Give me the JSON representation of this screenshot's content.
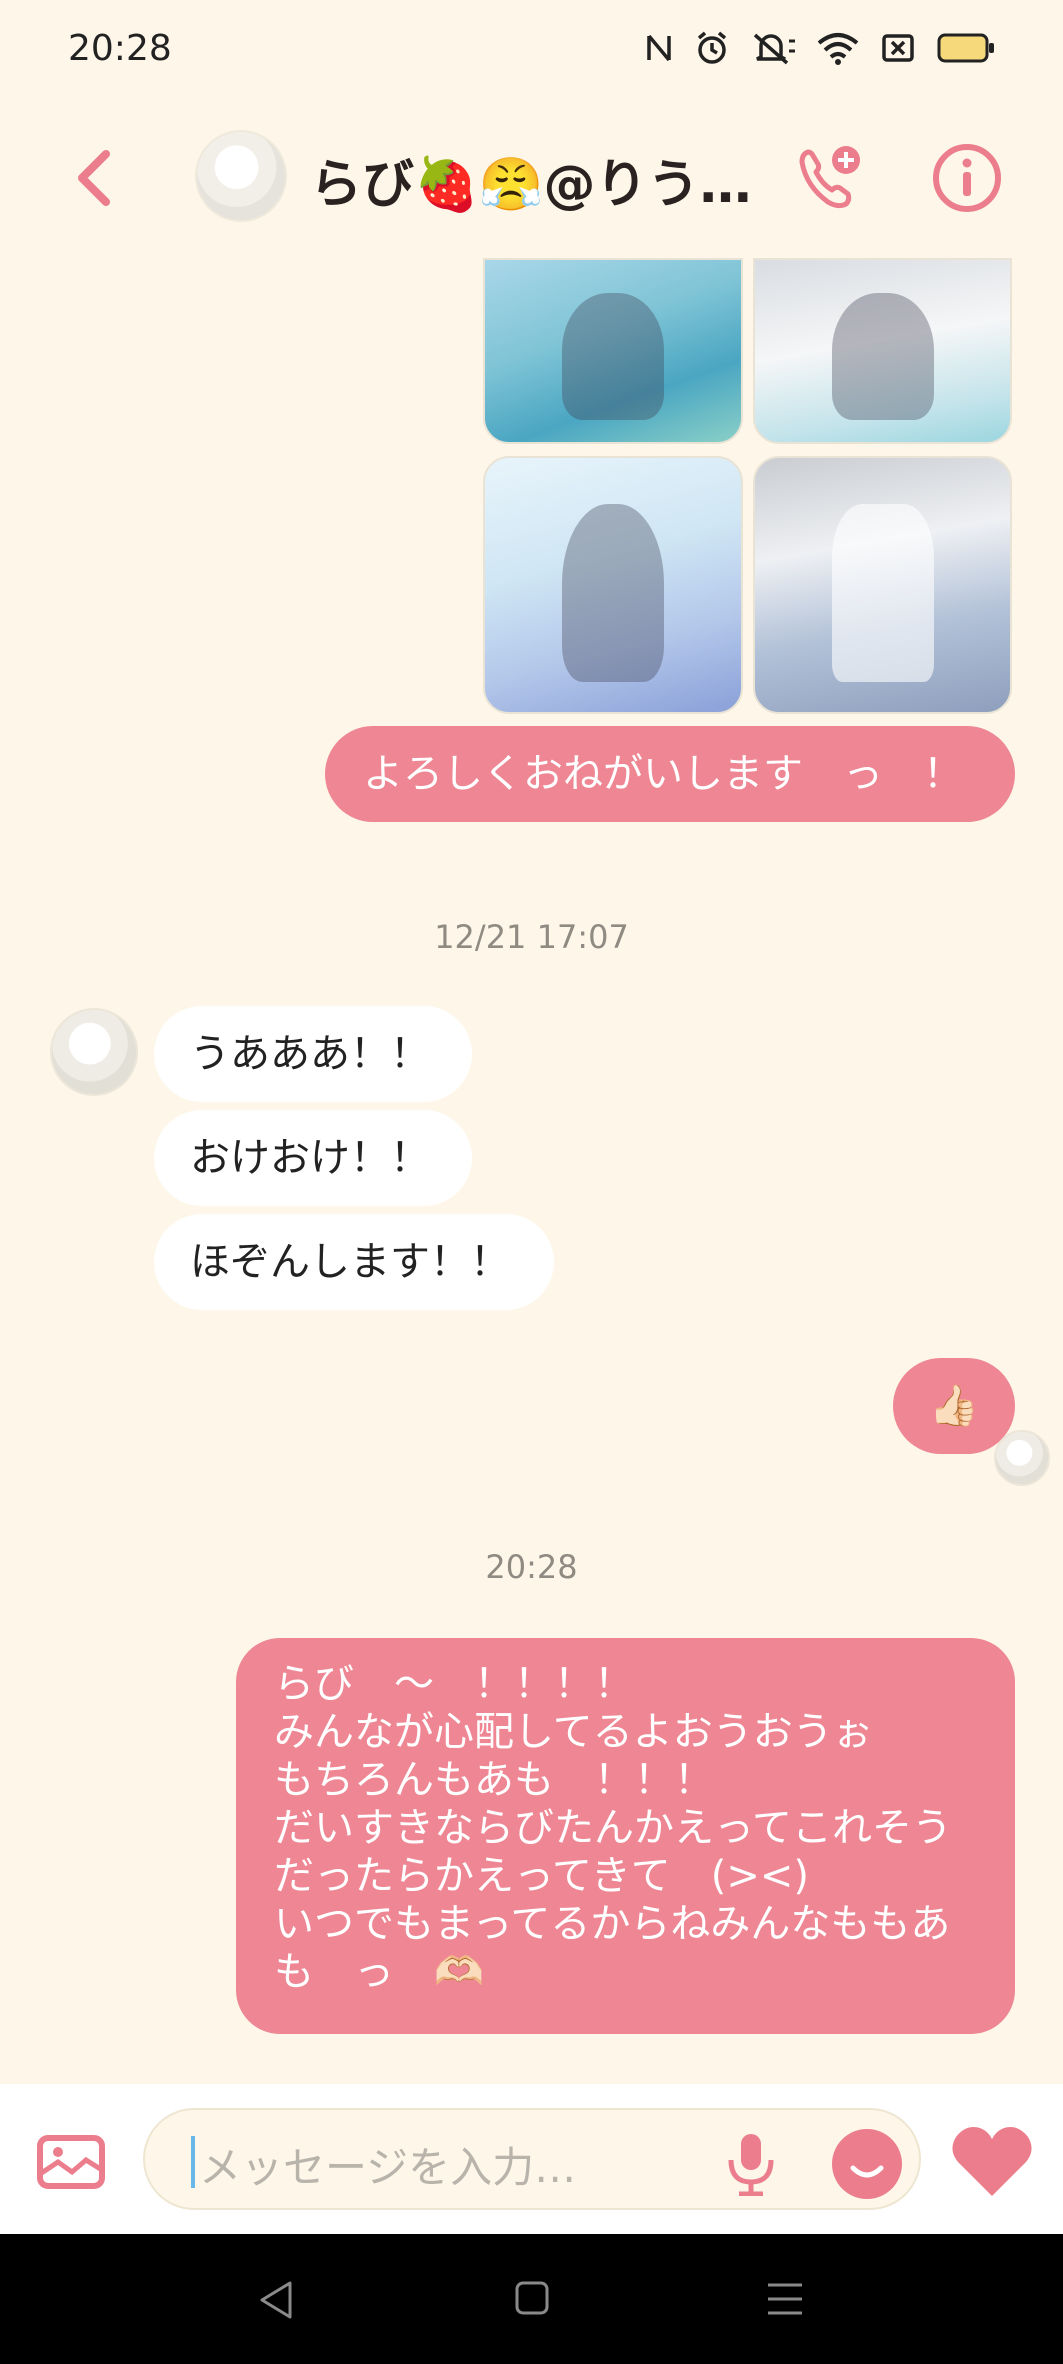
{
  "status_bar": {
    "time": "20:28"
  },
  "header": {
    "title": "らび🍓😤@りうっ…"
  },
  "messages": {
    "out_1": "よろしくおねがいします　っ　！",
    "timestamp_1": "12/21 17:07",
    "in_1": "うあああ！！",
    "in_2": "おけおけ！！",
    "in_3": "ほぞんします！！",
    "reaction_emoji": "👍🏻",
    "timestamp_2": "20:28",
    "out_2_lines": [
      "らび　～　！！！！",
      "みんなが心配してるよおうおうぉ",
      "もちろんもあも　！！！",
      "だいすきならびたんかえってこれそう",
      "だったらかえってきて　(><)",
      "いつでもまってるからねみんなももあ",
      "も　っ　🫶🏻"
    ]
  },
  "input": {
    "placeholder": "メッセージを入力…"
  },
  "colors": {
    "background": "#fdf6e9",
    "accent_pink": "#ee8693",
    "icon_pink": "#ec7d8c"
  },
  "icons": {
    "back": "chevron-left-icon",
    "call": "call-add-icon",
    "info": "info-icon",
    "gallery": "gallery-icon",
    "mic": "mic-icon",
    "emoji": "emoji-icon",
    "like": "heart-icon"
  }
}
